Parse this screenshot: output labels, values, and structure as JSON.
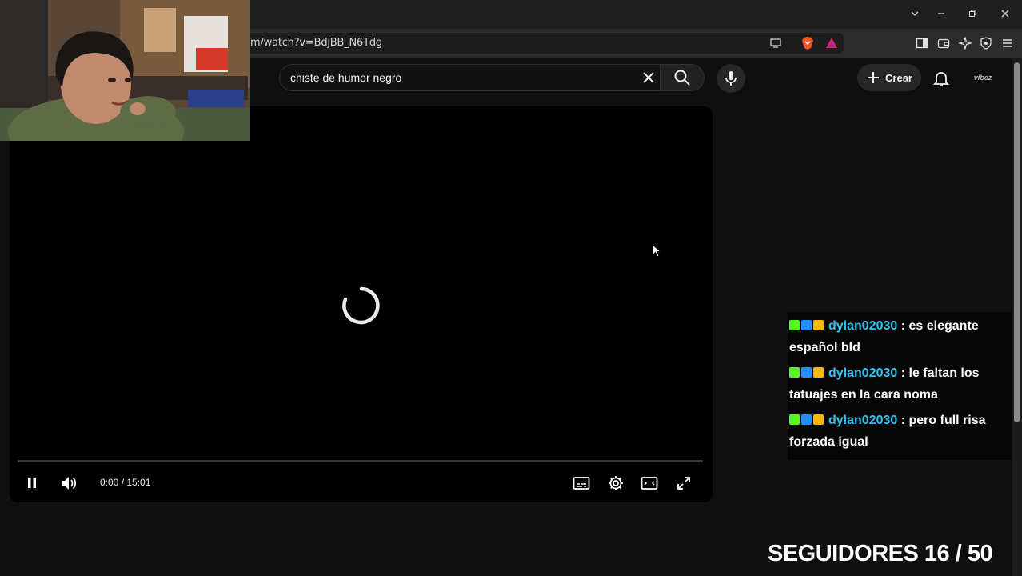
{
  "browser": {
    "url": "m/watch?v=BdjBB_N6Tdg",
    "window_controls": [
      "chevron-down",
      "minimize",
      "restore",
      "close"
    ],
    "toolbar_icons": [
      "cast-icon",
      "brave-shields-icon",
      "brave-rewards-icon",
      "sidebar-icon",
      "wallet-icon",
      "leo-ai-icon",
      "vpn-icon",
      "menu-icon"
    ]
  },
  "youtube": {
    "search": {
      "value": "chiste de humor negro"
    },
    "create_label": "Crear",
    "avatar_text": "vibez"
  },
  "player": {
    "state": "loading",
    "time": "0:00 / 15:01",
    "progress": 0
  },
  "chat": {
    "messages": [
      {
        "user": "dylan02030",
        "text": ": es elegante español bld"
      },
      {
        "user": "dylan02030",
        "text": ": le faltan los tatuajes en la cara noma"
      },
      {
        "user": "dylan02030",
        "text": ": pero full risa forzada igual"
      }
    ],
    "badge_colors": [
      "#53fc18",
      "#1e90ff",
      "#f5b800"
    ]
  },
  "overlay": {
    "followers": "SEGUIDORES 16 / 50"
  },
  "colors": {
    "background": "#0f0f0f",
    "username": "#2ec4f1",
    "accent_red": "#e53935"
  }
}
